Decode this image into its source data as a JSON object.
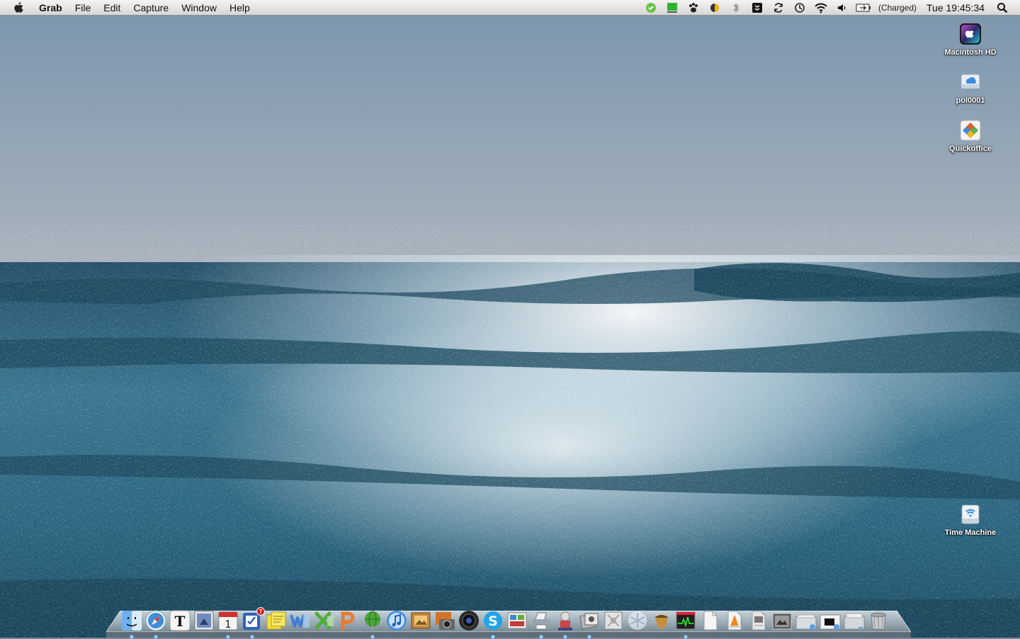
{
  "menubar": {
    "app_name": "Grab",
    "items": [
      "File",
      "Edit",
      "Capture",
      "Window",
      "Help"
    ],
    "battery_status": "(Charged)",
    "clock": "Tue 19:45:34",
    "status_icons": [
      "evernote-icon",
      "green-monitor-icon",
      "paw-icon",
      "moon-icon",
      "bluetooth-icon",
      "dropbox-icon",
      "sync-icon",
      "time-machine-clock-icon",
      "wifi-icon",
      "volume-icon",
      "battery-icon"
    ]
  },
  "desktop": {
    "icons": [
      {
        "label": "Macintosh HD",
        "icon": "hard-drive-icon"
      },
      {
        "label": "pol0001",
        "icon": "network-drive-icon"
      },
      {
        "label": "Quickoffice",
        "icon": "quickoffice-icon"
      },
      {
        "label": "Time Machine",
        "icon": "time-machine-drive-icon"
      }
    ]
  },
  "dock": {
    "items": [
      {
        "name": "finder",
        "icon": "finder-icon",
        "color": "#3b86d6"
      },
      {
        "name": "safari",
        "icon": "safari-icon",
        "color": "#3c8fd8"
      },
      {
        "name": "nytimes",
        "icon": "nytimes-icon",
        "color": "#f5f5f5"
      },
      {
        "name": "preview",
        "icon": "preview-icon",
        "color": "#6e8cbf"
      },
      {
        "name": "ical",
        "icon": "calendar-icon",
        "color": "#f2f2f2",
        "text": "1"
      },
      {
        "name": "things",
        "icon": "task-checkbox-icon",
        "color": "#2e63b8",
        "badge": "7"
      },
      {
        "name": "stickies",
        "icon": "stickies-icon",
        "color": "#f5df3c"
      },
      {
        "name": "word",
        "icon": "word-icon",
        "color": "#3c7fd4"
      },
      {
        "name": "excel",
        "icon": "excel-icon",
        "color": "#4fae3b"
      },
      {
        "name": "powerpoint",
        "icon": "powerpoint-icon",
        "color": "#e67d2e"
      },
      {
        "name": "network-globe",
        "icon": "globe-icon",
        "color": "#4ca63c"
      },
      {
        "name": "itunes",
        "icon": "itunes-icon",
        "color": "#4b8fe0"
      },
      {
        "name": "iphoto-1",
        "icon": "photo-frame-icon",
        "color": "#c4883a"
      },
      {
        "name": "iphoto-2",
        "icon": "photo-camera-icon",
        "color": "#d3732a"
      },
      {
        "name": "aperture",
        "icon": "lens-icon",
        "color": "#2b2b2b"
      },
      {
        "name": "skype",
        "icon": "skype-icon",
        "color": "#1ea5e8"
      },
      {
        "name": "photo-booth",
        "icon": "photo-booth-icon",
        "color": "#c23b3b"
      },
      {
        "name": "printer",
        "icon": "printer-icon",
        "color": "#9aa3ad"
      },
      {
        "name": "app-robot",
        "icon": "robot-icon",
        "color": "#c44"
      },
      {
        "name": "preview-2",
        "icon": "photos-icon",
        "color": "#b7b7b7"
      },
      {
        "name": "script-editor",
        "icon": "script-icon",
        "color": "#a8a8a8"
      },
      {
        "name": "snow",
        "icon": "snowflake-icon",
        "color": "#e8eef5"
      },
      {
        "name": "acorn",
        "icon": "acorn-icon",
        "color": "#9a6b2a"
      },
      {
        "name": "activity-monitor",
        "icon": "activity-monitor-icon",
        "color": "#202020"
      },
      {
        "name": "document-1",
        "icon": "document-icon",
        "color": "#f4f4f4"
      },
      {
        "name": "vlc",
        "icon": "vlc-cone-icon",
        "color": "#f08a1c"
      },
      {
        "name": "pdf-doc",
        "icon": "pdf-document-icon",
        "color": "#e6e6e6"
      },
      {
        "name": "movie-folder",
        "icon": "movie-thumbnail-icon",
        "color": "#5e5e5e"
      },
      {
        "name": "downloads-stack",
        "icon": "downloads-stack-icon",
        "color": "#d8dde3"
      },
      {
        "name": "screen-stack",
        "icon": "screen-stack-icon",
        "color": "#e4e4e4"
      },
      {
        "name": "docs-stack",
        "icon": "documents-stack-icon",
        "color": "#d4d8de"
      },
      {
        "name": "trash",
        "icon": "trash-icon",
        "color": "#9ba4ad"
      }
    ]
  },
  "colors": {
    "sky_top": "#7d96ae",
    "sky_horizon": "#a8b2bd",
    "sea_dark": "#1e4c64",
    "sea_mid": "#3d7591",
    "glare": "#eef4f8"
  }
}
